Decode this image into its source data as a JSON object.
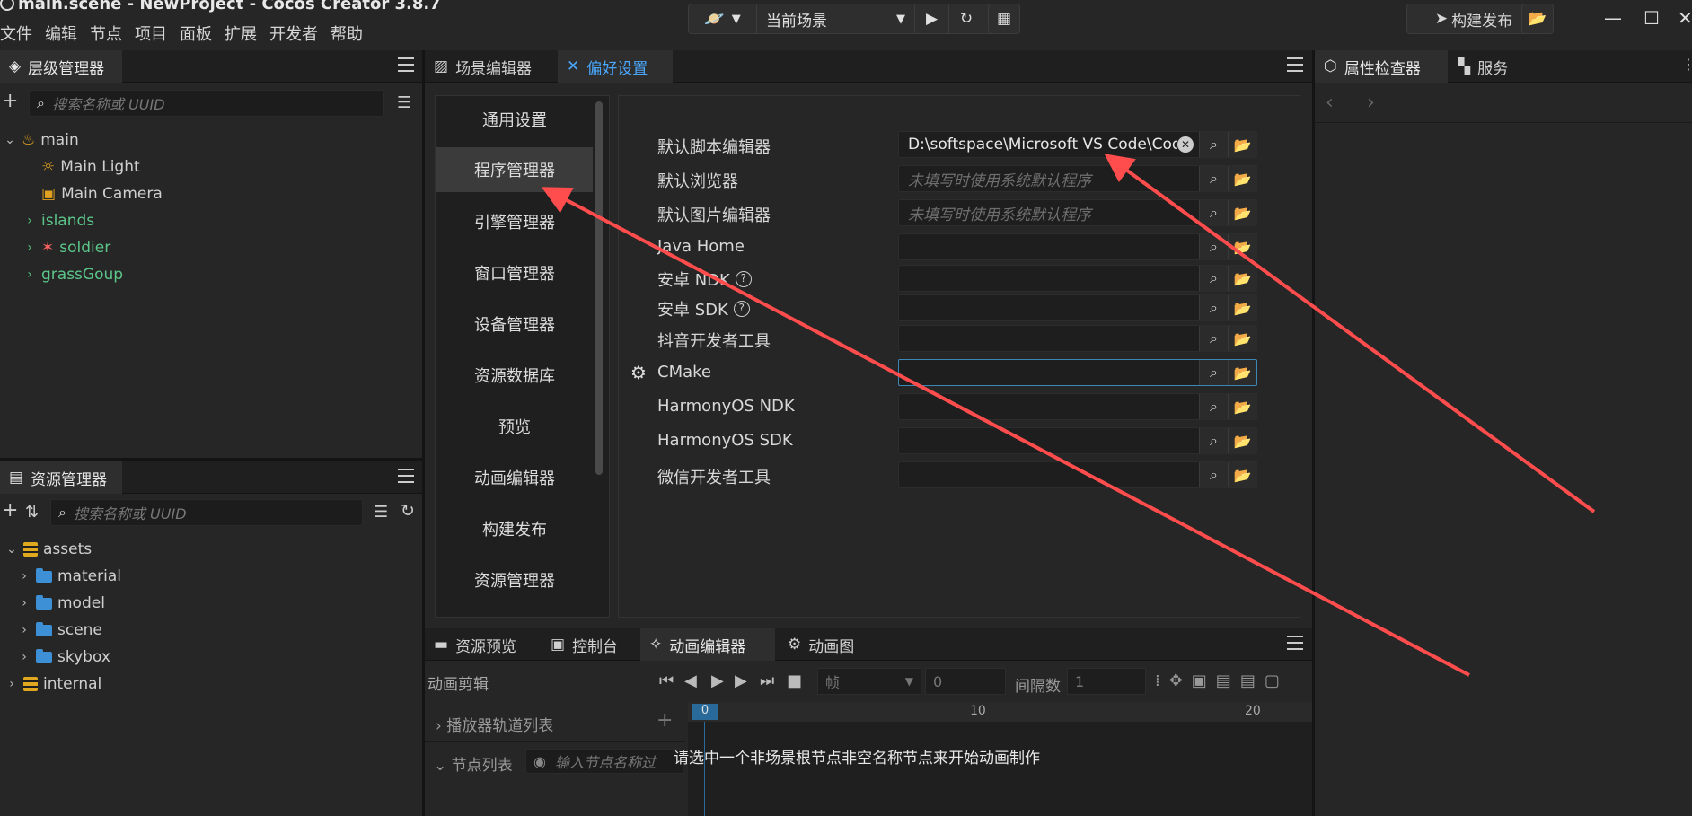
{
  "window": {
    "title": "main.scene - NewProject - Cocos Creator 3.8.7"
  },
  "menu": [
    "文件",
    "编辑",
    "节点",
    "项目",
    "面板",
    "扩展",
    "开发者",
    "帮助"
  ],
  "toolbar": {
    "scene_select": "当前场景",
    "build_button": "构建发布"
  },
  "hierarchy": {
    "tab": "层级管理器",
    "search_placeholder": "搜索名称或 UUID",
    "items": [
      {
        "label": "main"
      },
      {
        "label": "Main Light"
      },
      {
        "label": "Main Camera"
      },
      {
        "label": "islands"
      },
      {
        "label": "soldier"
      },
      {
        "label": "grassGoup"
      }
    ]
  },
  "assets": {
    "tab": "资源管理器",
    "search_placeholder": "搜索名称或 UUID",
    "items": [
      {
        "label": "assets"
      },
      {
        "label": "material"
      },
      {
        "label": "model"
      },
      {
        "label": "scene"
      },
      {
        "label": "skybox"
      },
      {
        "label": "internal"
      }
    ]
  },
  "center_tabs": {
    "scene_editor": "场景编辑器",
    "preferences": "偏好设置"
  },
  "prefs_nav": [
    "通用设置",
    "程序管理器",
    "引擎管理器",
    "窗口管理器",
    "设备管理器",
    "资源数据库",
    "预览",
    "动画编辑器",
    "构建发布",
    "资源管理器"
  ],
  "prefs_fields": [
    {
      "label": "默认脚本编辑器",
      "value": "D:\\softspace\\Microsoft VS Code\\Code",
      "placeholder": ""
    },
    {
      "label": "默认浏览器",
      "value": "",
      "placeholder": "未填写时使用系统默认程序"
    },
    {
      "label": "默认图片编辑器",
      "value": "",
      "placeholder": "未填写时使用系统默认程序"
    },
    {
      "label": "Java Home",
      "value": "",
      "placeholder": ""
    },
    {
      "label": "安卓 NDK",
      "value": "",
      "placeholder": ""
    },
    {
      "label": "安卓 SDK",
      "value": "",
      "placeholder": ""
    },
    {
      "label": "抖音开发者工具",
      "value": "",
      "placeholder": ""
    },
    {
      "label": "CMake",
      "value": "",
      "placeholder": ""
    },
    {
      "label": "HarmonyOS NDK",
      "value": "",
      "placeholder": ""
    },
    {
      "label": "HarmonyOS SDK",
      "value": "",
      "placeholder": ""
    },
    {
      "label": "微信开发者工具",
      "value": "",
      "placeholder": ""
    }
  ],
  "right_tabs": {
    "inspector": "属性检查器",
    "services": "服务"
  },
  "bottom_tabs": {
    "asset_preview": "资源预览",
    "console": "控制台",
    "anim_editor": "动画编辑器",
    "anim_graph": "动画图"
  },
  "anim": {
    "clip_label": "动画剪辑",
    "frame_unit": "帧",
    "frame_value": "0",
    "interval_label": "间隔数",
    "interval_value": "1",
    "player_tracks": "播放器轨道列表",
    "node_list": "节点列表",
    "node_search_placeholder": "输入节点名称过",
    "ruler": [
      "0",
      "10",
      "20"
    ],
    "hint": "请选中一个非场景根节点非空名称节点来开始动画制作"
  },
  "colors": {
    "accent": "#4aa8ff",
    "arrow": "#ff4d4d",
    "node_green": "#5cc68a"
  }
}
